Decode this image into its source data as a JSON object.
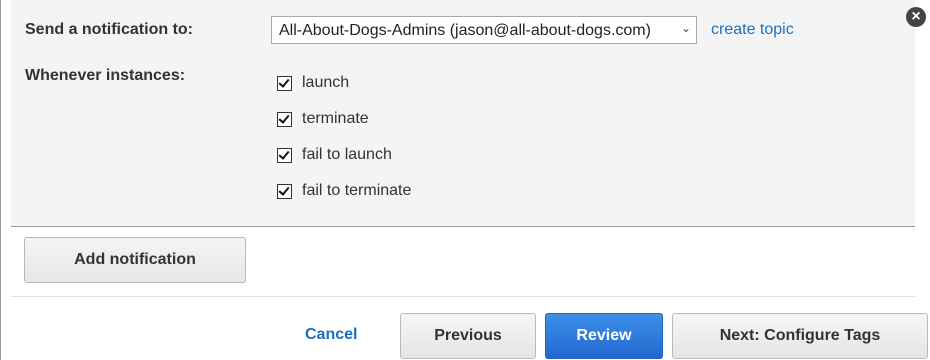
{
  "notification": {
    "send_label": "Send a notification to:",
    "topic_value": "All-About-Dogs-Admins (jason@all-about-dogs.com)",
    "create_topic_link": "create topic",
    "whenever_label": "Whenever instances:",
    "events": [
      {
        "label": "launch",
        "checked": true
      },
      {
        "label": "terminate",
        "checked": true
      },
      {
        "label": "fail to launch",
        "checked": true
      },
      {
        "label": "fail to terminate",
        "checked": true
      }
    ],
    "close_icon": "×"
  },
  "actions": {
    "add_notification": "Add notification"
  },
  "footer": {
    "cancel": "Cancel",
    "previous": "Previous",
    "review": "Review",
    "next": "Next: Configure Tags"
  },
  "colors": {
    "link": "#1a70c0",
    "primary": "#2268cf",
    "panel_bg": "#f4f4f4"
  }
}
